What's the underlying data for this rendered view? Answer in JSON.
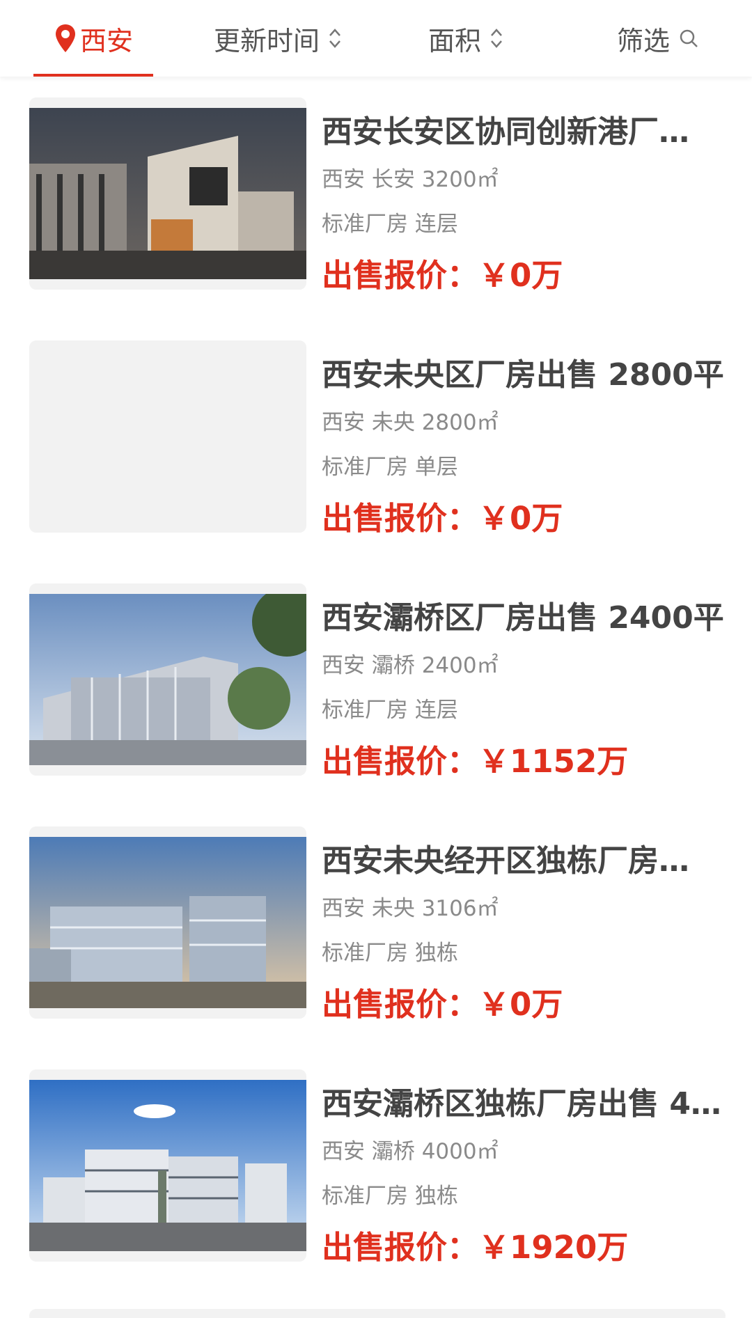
{
  "header": {
    "city": "西安",
    "sort_update": "更新时间",
    "sort_area": "面积",
    "filter": "筛选",
    "accent_color": "#e0301e"
  },
  "listings": [
    {
      "title": "西安长安区协同创新港厂…",
      "meta": "西安 长安 3200㎡",
      "tags": "标准厂房 连层",
      "price_label": "出售报价：",
      "price": "￥0万"
    },
    {
      "title": "西安未央区厂房出售 2800平",
      "meta": "西安 未央 2800㎡",
      "tags": "标准厂房 单层",
      "price_label": "出售报价：",
      "price": "￥0万"
    },
    {
      "title": "西安灞桥区厂房出售 2400平",
      "meta": "西安 灞桥 2400㎡",
      "tags": "标准厂房 连层",
      "price_label": "出售报价：",
      "price": "￥1152万"
    },
    {
      "title": "西安未央经开区独栋厂房…",
      "meta": "西安 未央 3106㎡",
      "tags": "标准厂房 独栋",
      "price_label": "出售报价：",
      "price": "￥0万"
    },
    {
      "title": "西安灞桥区独栋厂房出售 4…",
      "meta": "西安 灞桥 4000㎡",
      "tags": "标准厂房 独栋",
      "price_label": "出售报价：",
      "price": "￥1920万"
    }
  ]
}
